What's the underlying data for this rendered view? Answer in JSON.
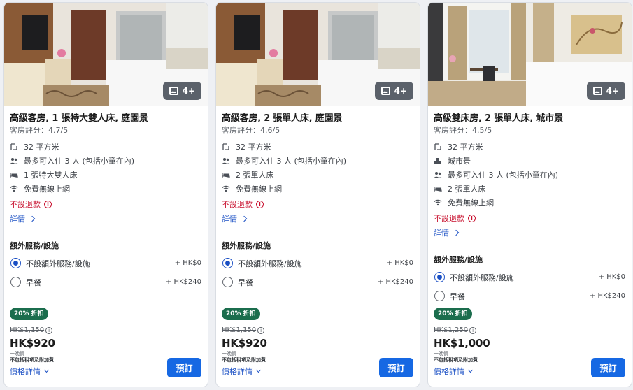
{
  "colors": {
    "accent": "#1668e3",
    "link": "#1a4fc4",
    "non_refundable": "#c8102e",
    "discount_badge": "#1b6d4d"
  },
  "rooms": [
    {
      "photo_count": "4+",
      "title": "高級客房, 1 張特大雙人床, 庭園景",
      "rating": "客房評分：4.7/5",
      "features": [
        {
          "icon": "floor-area-icon",
          "text": "32 平方米"
        },
        {
          "icon": "occupancy-icon",
          "text": "最多可入住 3 人 (包括小童在內)"
        },
        {
          "icon": "bed-icon",
          "text": "1 張特大雙人床"
        },
        {
          "icon": "wifi-icon",
          "text": "免費無線上網"
        }
      ],
      "non_refundable": "不設退款",
      "details_link": "詳情",
      "extras_title": "額外服務/設施",
      "options": [
        {
          "label": "不設額外服務/設施",
          "price": "+ HK$0",
          "selected": true
        },
        {
          "label": "早餐",
          "price": "+ HK$240",
          "selected": false
        }
      ],
      "discount": "20% 折扣",
      "old_price": "HK$1,150",
      "price": "HK$920",
      "nightly": "一晚價",
      "taxes": "不包括稅項及附加費",
      "price_details": "價格詳情",
      "book": "預訂"
    },
    {
      "photo_count": "4+",
      "title": "高級客房, 2 張單人床, 庭園景",
      "rating": "客房評分：4.6/5",
      "features": [
        {
          "icon": "floor-area-icon",
          "text": "32 平方米"
        },
        {
          "icon": "occupancy-icon",
          "text": "最多可入住 3 人 (包括小童在內)"
        },
        {
          "icon": "bed-icon",
          "text": "2 張單人床"
        },
        {
          "icon": "wifi-icon",
          "text": "免費無線上網"
        }
      ],
      "non_refundable": "不設退款",
      "details_link": "詳情",
      "extras_title": "額外服務/設施",
      "options": [
        {
          "label": "不設額外服務/設施",
          "price": "+ HK$0",
          "selected": true
        },
        {
          "label": "早餐",
          "price": "+ HK$240",
          "selected": false
        }
      ],
      "discount": "20% 折扣",
      "old_price": "HK$1,150",
      "price": "HK$920",
      "nightly": "一晚價",
      "taxes": "不包括稅項及附加費",
      "price_details": "價格詳情",
      "book": "預訂"
    },
    {
      "photo_count": "4+",
      "title": "高級雙床房, 2 張單人床, 城市景",
      "rating": "客房評分：4.5/5",
      "features": [
        {
          "icon": "floor-area-icon",
          "text": "32 平方米"
        },
        {
          "icon": "city-view-icon",
          "text": "城市景"
        },
        {
          "icon": "occupancy-icon",
          "text": "最多可入住 3 人 (包括小童在內)"
        },
        {
          "icon": "bed-icon",
          "text": "2 張單人床"
        },
        {
          "icon": "wifi-icon",
          "text": "免費無線上網"
        }
      ],
      "non_refundable": "不設退款",
      "details_link": "詳情",
      "extras_title": "額外服務/設施",
      "options": [
        {
          "label": "不設額外服務/設施",
          "price": "+ HK$0",
          "selected": true
        },
        {
          "label": "早餐",
          "price": "+ HK$240",
          "selected": false
        }
      ],
      "discount": "20% 折扣",
      "old_price": "HK$1,250",
      "price": "HK$1,000",
      "nightly": "一晚價",
      "taxes": "不包括稅項及附加費",
      "price_details": "價格詳情",
      "book": "預訂"
    }
  ]
}
